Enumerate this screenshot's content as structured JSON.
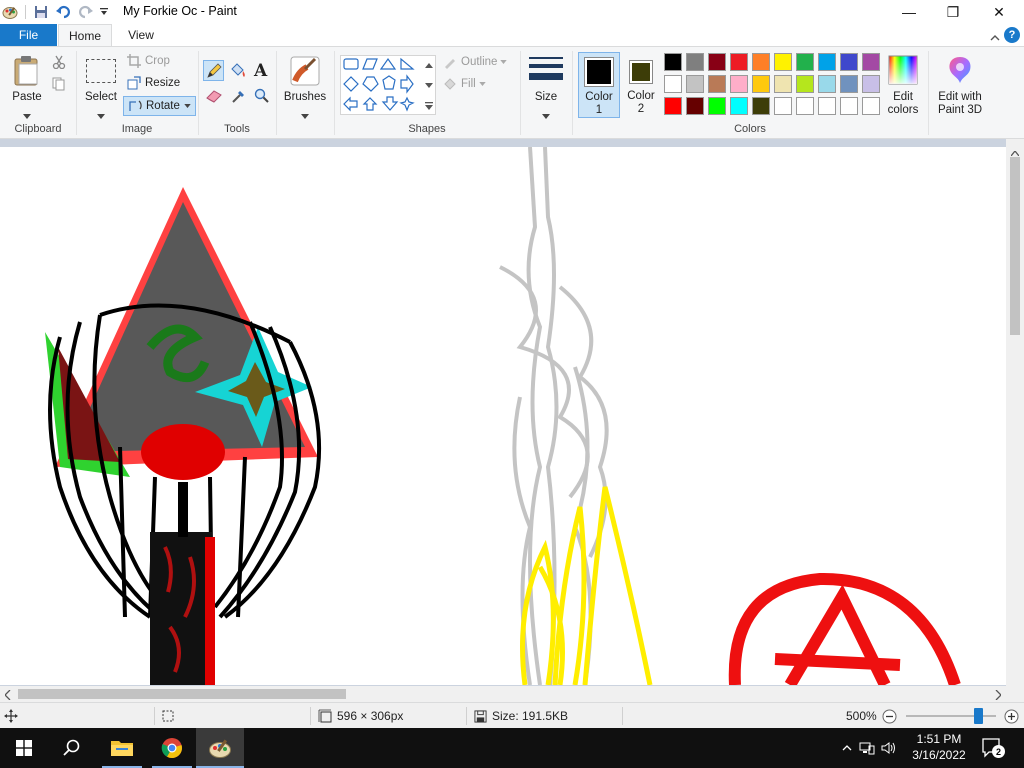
{
  "window": {
    "title": "My Forkie Oc - Paint",
    "minimize_glyph": "—",
    "maximize_glyph": "❐",
    "close_glyph": "✕"
  },
  "tabs": {
    "file": "File",
    "home": "Home",
    "view": "View",
    "help_glyph": "?"
  },
  "clipboard": {
    "paste": "Paste",
    "group": "Clipboard"
  },
  "image": {
    "select": "Select",
    "crop": "Crop",
    "resize": "Resize",
    "rotate": "Rotate",
    "group": "Image"
  },
  "tools": {
    "group": "Tools"
  },
  "brushes": {
    "label": "Brushes"
  },
  "shapes": {
    "outline": "Outline",
    "fill": "Fill",
    "group": "Shapes"
  },
  "size": {
    "label": "Size"
  },
  "colors": {
    "color1_label": "Color",
    "color1_num": "1",
    "color2_label": "Color",
    "color2_num": "2",
    "color1_value": "#000000",
    "color2_value": "#3d3d08",
    "palette": [
      "#000000",
      "#7f7f7f",
      "#880015",
      "#ed1c24",
      "#ff7f27",
      "#fff200",
      "#22b14c",
      "#00a2e8",
      "#3f48cc",
      "#a349a4",
      "#ffffff",
      "#c3c3c3",
      "#b97a57",
      "#ffaec9",
      "#ffc90e",
      "#efe4b0",
      "#b5e61d",
      "#99d9ea",
      "#7092be",
      "#c8bfe7",
      "#ff0000",
      "#660000",
      "#00ff00",
      "#00ffff",
      "#3d3d08",
      "#ffffff",
      "#ffffff",
      "#ffffff",
      "#ffffff",
      "#ffffff"
    ],
    "edit_colors_1": "Edit",
    "edit_colors_2": "colors",
    "paint3d_1": "Edit with",
    "paint3d_2": "Paint 3D",
    "group": "Colors"
  },
  "status": {
    "dimensions": "596 × 306px",
    "size": "Size: 191.5KB",
    "zoom": "500%",
    "zoom_level": 0.8
  },
  "taskbar": {
    "time": "1:51 PM",
    "date": "3/16/2022",
    "notifications": "2"
  }
}
